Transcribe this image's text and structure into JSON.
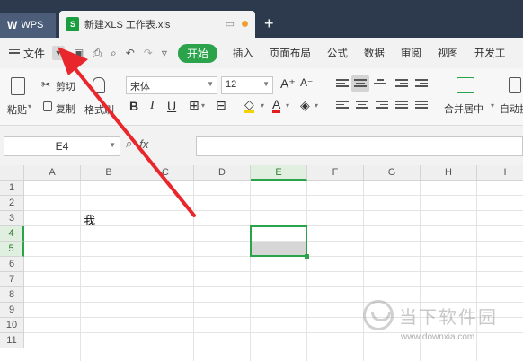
{
  "titlebar": {
    "app_tab": "WPS",
    "file_tab": "新建XLS 工作表.xls",
    "new_tab_symbol": "+"
  },
  "menubar": {
    "file_label": "文件",
    "start_label": "开始",
    "items": [
      "插入",
      "页面布局",
      "公式",
      "数据",
      "审阅",
      "视图",
      "开发工"
    ]
  },
  "ribbon": {
    "paste": "粘贴",
    "cut": "剪切",
    "copy": "复制",
    "format_painter": "格式刷",
    "font_name": "宋体",
    "font_size": "12",
    "merge_center": "合并居中",
    "wrap": "自动换"
  },
  "formulabar": {
    "cell_ref": "E4",
    "fx": "fx",
    "formula": ""
  },
  "grid": {
    "columns": [
      "A",
      "B",
      "C",
      "D",
      "E",
      "F",
      "G",
      "H",
      "I"
    ],
    "active_column": "E",
    "rows": [
      "1",
      "2",
      "3",
      "4",
      "5",
      "6",
      "7",
      "8",
      "9",
      "10",
      "11"
    ],
    "active_rows": [
      "4",
      "5"
    ],
    "cells": [
      {
        "ref": "B3",
        "value": "我"
      }
    ]
  },
  "watermark": {
    "brand": "当下软件园",
    "url": "www.downxia.com"
  },
  "colors": {
    "accent_green": "#2aa34b",
    "titlebar_bg": "#2d3a4e",
    "annotation_red": "#e8262b"
  }
}
